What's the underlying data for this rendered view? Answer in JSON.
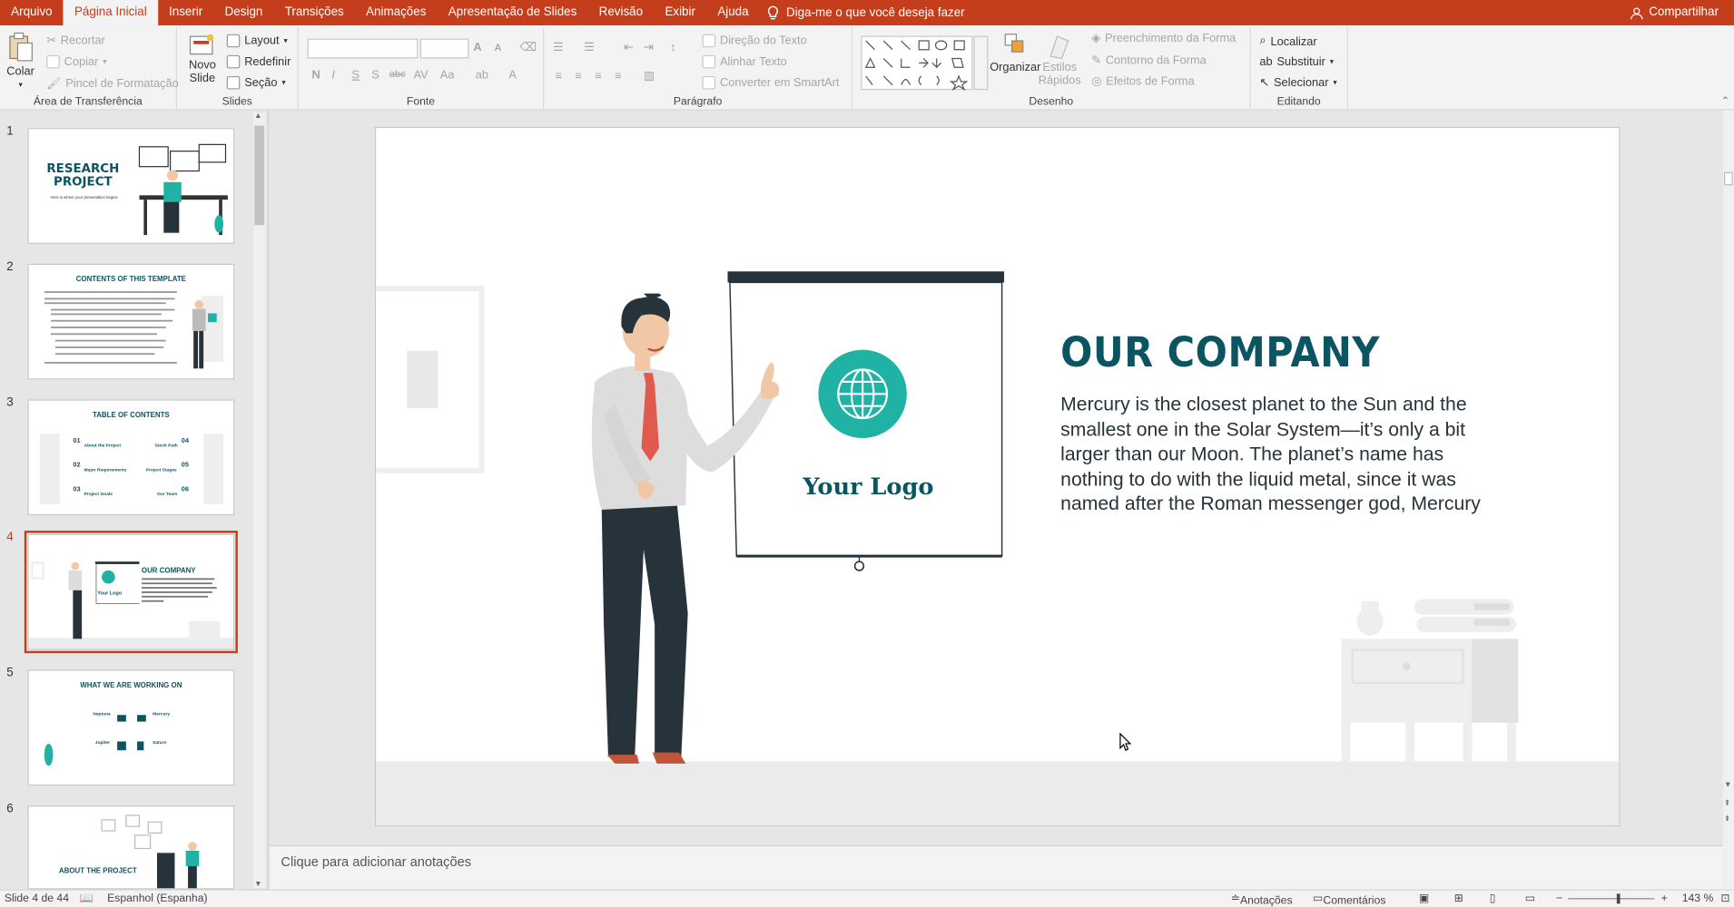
{
  "menu": {
    "tabs": [
      "Arquivo",
      "Página Inicial",
      "Inserir",
      "Design",
      "Transições",
      "Animações",
      "Apresentação de Slides",
      "Revisão",
      "Exibir",
      "Ajuda"
    ],
    "tell_me": "Diga-me o que você deseja fazer",
    "share": "Compartilhar"
  },
  "ribbon": {
    "clipboard": {
      "paste": "Colar",
      "cut": "Recortar",
      "copy": "Copiar",
      "format_painter": "Pincel de Formatação",
      "label": "Área de Transferência"
    },
    "slides": {
      "new_slide_1": "Novo",
      "new_slide_2": "Slide",
      "layout": "Layout",
      "reset": "Redefinir",
      "section": "Seção",
      "label": "Slides"
    },
    "font": {
      "label": "Fonte"
    },
    "paragraph": {
      "text_direction": "Direção do Texto",
      "align_text": "Alinhar Texto",
      "smartart": "Converter em SmartArt",
      "label": "Parágrafo"
    },
    "drawing": {
      "arrange": "Organizar",
      "quick_styles_1": "Estilos",
      "quick_styles_2": "Rápidos",
      "fill": "Preenchimento da Forma",
      "outline": "Contorno da Forma",
      "effects": "Efeitos de Forma",
      "label": "Desenho"
    },
    "editing": {
      "find": "Localizar",
      "replace": "Substituir",
      "select": "Selecionar",
      "label": "Editando"
    }
  },
  "thumbnails": [
    {
      "num": "1",
      "title": "RESEARCH PROJECT",
      "subtitle": "Here is where your presentation begins"
    },
    {
      "num": "2",
      "title": "CONTENTS OF THIS TEMPLATE"
    },
    {
      "num": "3",
      "title": "TABLE OF CONTENTS",
      "items": [
        "About the Project",
        "Stock Path",
        "Major Requirements",
        "Project Stages",
        "Project Goals",
        "Our Team"
      ],
      "nums": [
        "01",
        "04",
        "02",
        "05",
        "03",
        "06"
      ]
    },
    {
      "num": "4",
      "title": "OUR COMPANY",
      "logo": "Your Logo"
    },
    {
      "num": "5",
      "title": "WHAT WE ARE WORKING ON",
      "items": [
        "Neptune",
        "Mercury",
        "Jupiter",
        "Saturn"
      ]
    },
    {
      "num": "6",
      "title": "ABOUT THE PROJECT"
    }
  ],
  "slide": {
    "title": "OUR COMPANY",
    "body": "Mercury is the closest planet to the Sun and the smallest one in the Solar System—it’s only a bit larger than our Moon. The planet’s name has nothing to do with the liquid metal, since it was named after the Roman messenger god, Mercury",
    "logo_text": "Your Logo",
    "colors": {
      "teal": "#20b2a4",
      "dark": "#0b5563"
    }
  },
  "notes_placeholder": "Clique para adicionar anotações",
  "status": {
    "slide_info": "Slide 4 de 44",
    "language": "Espanhol (Espanha)",
    "notes": "Anotações",
    "comments": "Comentários",
    "zoom": "143 %"
  },
  "colors": {
    "accent": "#c43e1c",
    "ribbon_bg": "#f3f3f3"
  }
}
